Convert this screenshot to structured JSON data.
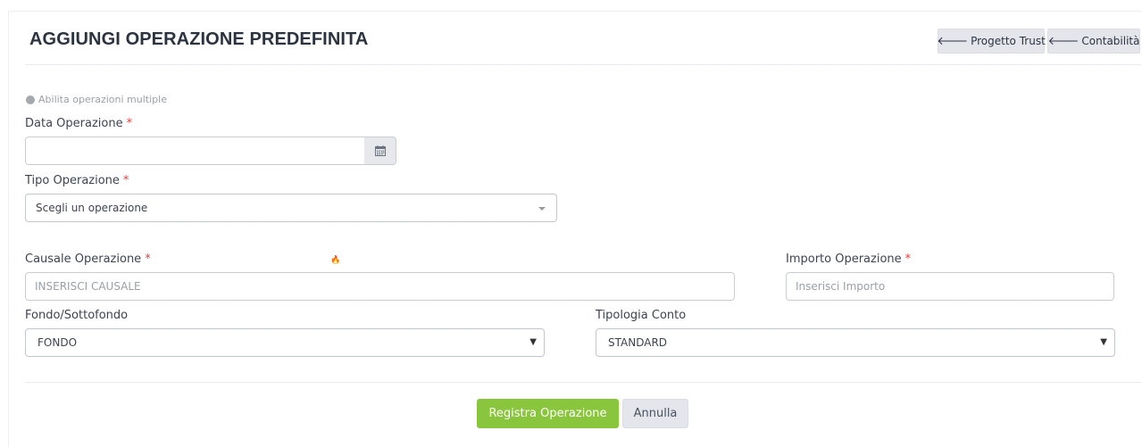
{
  "header": {
    "title": "AGGIUNGI OPERAZIONE PREDEFINITA",
    "nav_buttons": [
      {
        "label": "Progetto Trust",
        "icon": "arrow-left-icon"
      },
      {
        "label": "Contabilità",
        "icon": "arrow-left-icon"
      }
    ]
  },
  "form": {
    "multi_toggle_label": "Abilita operazioni multiple",
    "required_marker": "*",
    "data_operazione": {
      "label": "Data Operazione",
      "value": "",
      "placeholder": "",
      "icon": "calendar-icon"
    },
    "tipo_operazione": {
      "label": "Tipo Operazione",
      "selected": "Scegli un operazione"
    },
    "causale": {
      "label": "Causale Operazione",
      "placeholder": "INSERISCI CAUSALE",
      "value": "",
      "extra_icon": "fire-icon"
    },
    "importo": {
      "label": "Importo Operazione",
      "placeholder": "Inserisci Importo",
      "value": ""
    },
    "fondo": {
      "label": "Fondo/Sottofondo",
      "selected": "FONDO"
    },
    "tipologia_conto": {
      "label": "Tipologia Conto",
      "selected": "STANDARD"
    }
  },
  "actions": {
    "submit_label": "Registra Operazione",
    "cancel_label": "Annulla"
  },
  "colors": {
    "primary": "#8ac53e",
    "required": "#e53d3d",
    "secondary_bg": "#e4e6eb"
  }
}
